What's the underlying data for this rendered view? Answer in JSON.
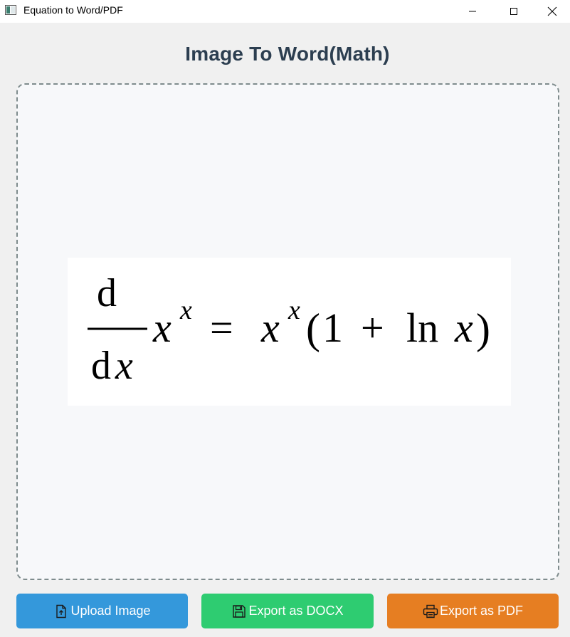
{
  "window": {
    "title": "Equation to Word/PDF",
    "controls": [
      "minimize",
      "maximize",
      "close"
    ]
  },
  "heading": "Image To Word(Math)",
  "dropzone": {
    "equation": {
      "numerator": "d",
      "denominator_d": "d",
      "denominator_x": "x",
      "base1": "x",
      "exp1": "x",
      "equals": "=",
      "base2": "x",
      "exp2": "x",
      "open_paren": "(",
      "one": "1",
      "plus": "+",
      "ln": "ln",
      "ln_arg": "x",
      "close_paren": ")"
    }
  },
  "buttons": {
    "upload": {
      "label": "Upload Image",
      "icon": "file-upload-icon",
      "color": "#3498db"
    },
    "docx": {
      "label": "Export as DOCX",
      "icon": "save-icon",
      "color": "#2ecc71"
    },
    "pdf": {
      "label": "Export as PDF",
      "icon": "printer-icon",
      "color": "#e67e22"
    }
  },
  "colors": {
    "heading": "#2c3e50",
    "dropzone_border": "#7f8c8d",
    "background": "#f0f0f0"
  }
}
